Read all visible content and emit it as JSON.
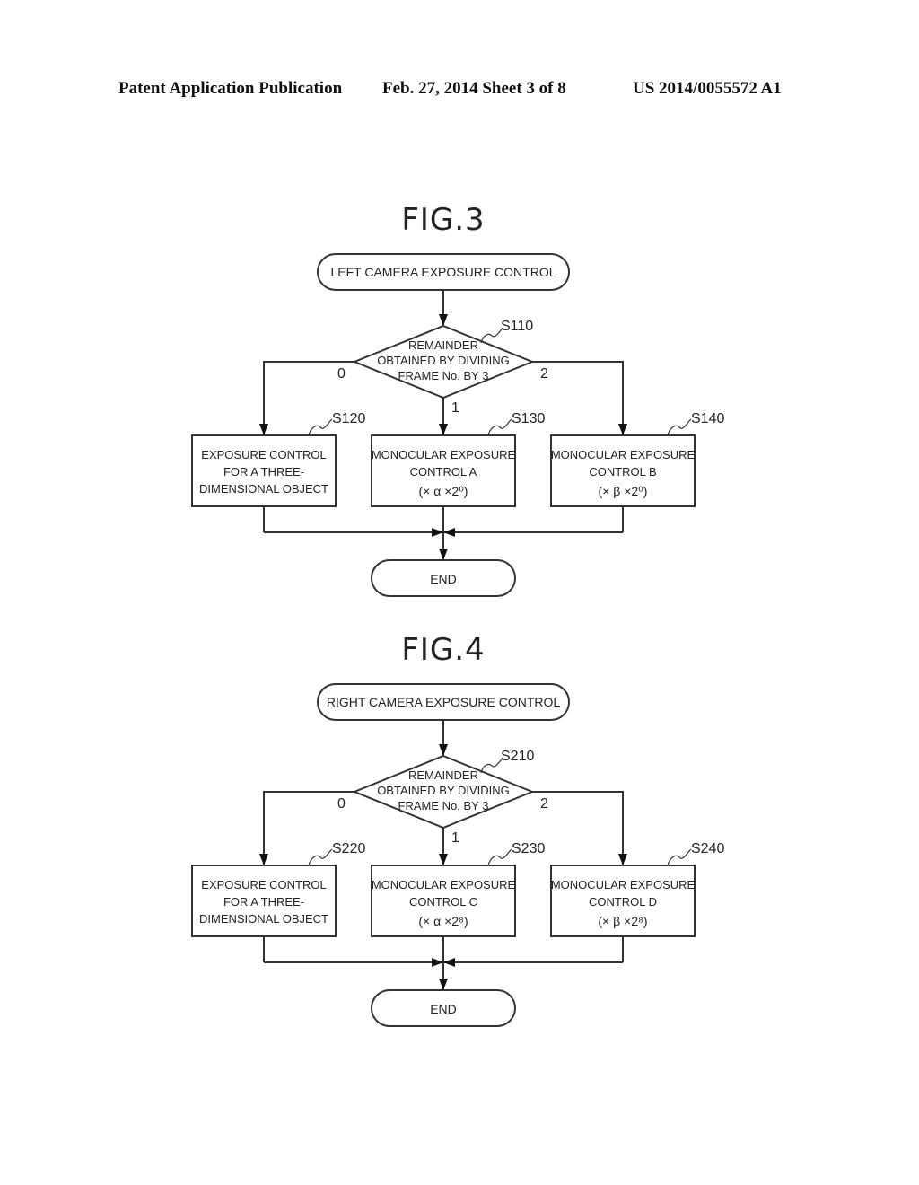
{
  "header": {
    "publication": "Patent Application Publication",
    "date_sheet": "Feb. 27, 2014   Sheet 3 of 8",
    "patent_number": "US 2014/0055572 A1"
  },
  "figures": [
    {
      "title": "FIG.3",
      "start": "LEFT CAMERA EXPOSURE CONTROL",
      "decision": {
        "step": "S110",
        "lines": [
          "REMAINDER",
          "OBTAINED BY DIVIDING",
          "FRAME No. BY 3"
        ]
      },
      "branches": [
        {
          "label": "0",
          "step": "S120",
          "lines": [
            "EXPOSURE CONTROL",
            "FOR A THREE-",
            "DIMENSIONAL OBJECT"
          ]
        },
        {
          "label": "1",
          "step": "S130",
          "lines": [
            "MONOCULAR EXPOSURE",
            "CONTROL A",
            "(× α ×2⁰)"
          ]
        },
        {
          "label": "2",
          "step": "S140",
          "lines": [
            "MONOCULAR EXPOSURE",
            "CONTROL B",
            "(× β ×2⁰)"
          ]
        }
      ],
      "end": "END"
    },
    {
      "title": "FIG.4",
      "start": "RIGHT CAMERA EXPOSURE CONTROL",
      "decision": {
        "step": "S210",
        "lines": [
          "REMAINDER",
          "OBTAINED BY DIVIDING",
          "FRAME No. BY 3"
        ]
      },
      "branches": [
        {
          "label": "0",
          "step": "S220",
          "lines": [
            "EXPOSURE CONTROL",
            "FOR A THREE-",
            "DIMENSIONAL OBJECT"
          ]
        },
        {
          "label": "1",
          "step": "S230",
          "lines": [
            "MONOCULAR EXPOSURE",
            "CONTROL C",
            "(× α ×2⁸)"
          ]
        },
        {
          "label": "2",
          "step": "S240",
          "lines": [
            "MONOCULAR EXPOSURE",
            "CONTROL D",
            "(× β ×2⁸)"
          ]
        }
      ],
      "end": "END"
    }
  ]
}
